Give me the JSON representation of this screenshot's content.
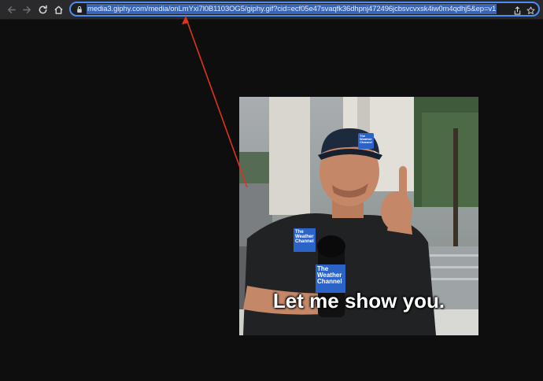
{
  "browser": {
    "url": "media3.giphy.com/media/onLmYxi7l0B1103OG5/giphy.gif?cid=ecf05e47svaqfk36dhpnj472496jcbsvcvxsk4iw0m4qdhj5&ep=v1",
    "icons": {
      "back": "back-arrow-icon",
      "forward": "forward-arrow-icon",
      "reload": "reload-icon",
      "home": "home-icon",
      "lock": "lock-icon",
      "share": "share-icon",
      "bookmark": "star-icon"
    },
    "accent_color": "#4a8df3"
  },
  "gif": {
    "caption": "Let me show you.",
    "cap_logo": "The Weather Channel",
    "mic_logo": "The Weather Channel",
    "shirt_logo": "The Weather Channel"
  },
  "annotation": {
    "arrow_color": "#e0321e"
  }
}
